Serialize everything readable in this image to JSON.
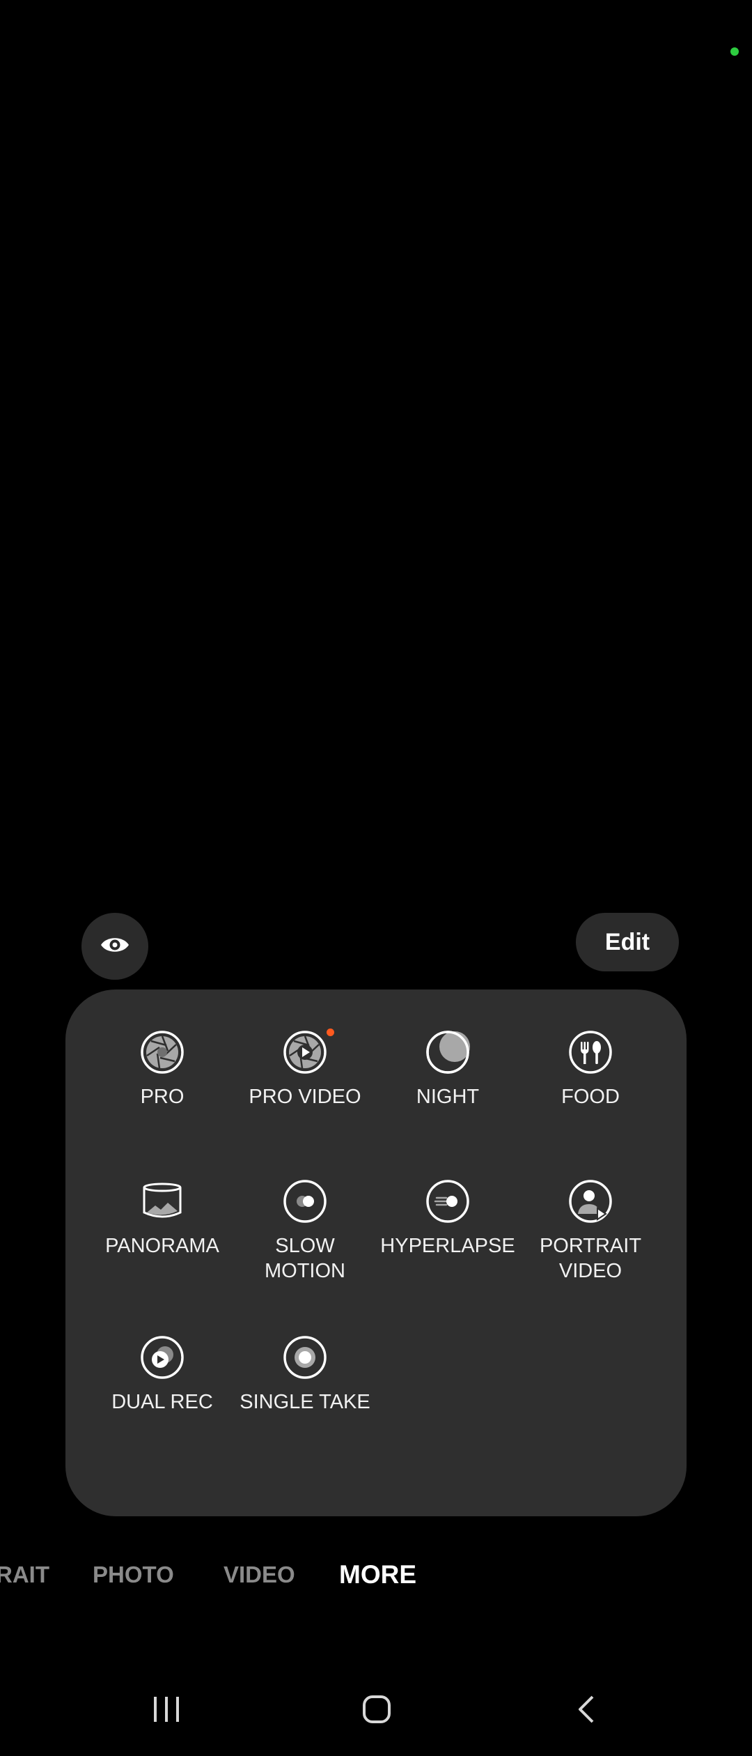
{
  "edit_button": {
    "label": "Edit"
  },
  "modes": [
    {
      "label": "PRO",
      "icon": "aperture-icon"
    },
    {
      "label": "PRO VIDEO",
      "icon": "aperture-play-icon",
      "badge": true,
      "badge_color": "#ff5a1f"
    },
    {
      "label": "NIGHT",
      "icon": "moon-icon"
    },
    {
      "label": "FOOD",
      "icon": "fork-spoon-icon"
    },
    {
      "label": "PANORAMA",
      "icon": "panorama-icon"
    },
    {
      "label": "SLOW\nMOTION",
      "icon": "slow-motion-icon"
    },
    {
      "label": "HYPERLAPSE",
      "icon": "hyperlapse-icon"
    },
    {
      "label": "PORTRAIT\nVIDEO",
      "icon": "portrait-video-icon"
    },
    {
      "label": "DUAL REC",
      "icon": "dual-rec-icon"
    },
    {
      "label": "SINGLE TAKE",
      "icon": "single-take-icon"
    }
  ],
  "mode_tabs": [
    {
      "label": "RAIT",
      "active": false
    },
    {
      "label": "PHOTO",
      "active": false
    },
    {
      "label": "VIDEO",
      "active": false
    },
    {
      "label": "MORE",
      "active": true
    }
  ],
  "colors": {
    "background": "#000000",
    "panel": "#2f2f2f",
    "button": "#2b2b2b",
    "status_indicator": "#2ecc40",
    "inactive_tab": "#8a8a8a",
    "active_tab": "#ffffff"
  },
  "nav": {
    "recent": "recent-apps-icon",
    "home": "home-icon",
    "back": "back-icon"
  }
}
